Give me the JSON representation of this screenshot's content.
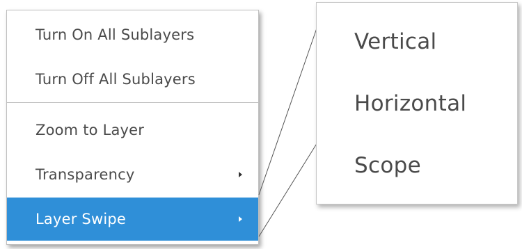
{
  "menu": {
    "items": [
      {
        "label": "Turn On All Sublayers"
      },
      {
        "label": "Turn Off All Sublayers"
      },
      {
        "label": "Zoom to Layer"
      },
      {
        "label": "Transparency"
      },
      {
        "label": "Layer Swipe"
      }
    ],
    "active_item": "Layer Swipe",
    "active_color": "#2f8fd8"
  },
  "submenu": {
    "items": [
      {
        "label": "Vertical"
      },
      {
        "label": "Horizontal"
      },
      {
        "label": "Scope"
      }
    ]
  },
  "icons": {
    "submenu_arrow": "chevron-right-icon"
  }
}
